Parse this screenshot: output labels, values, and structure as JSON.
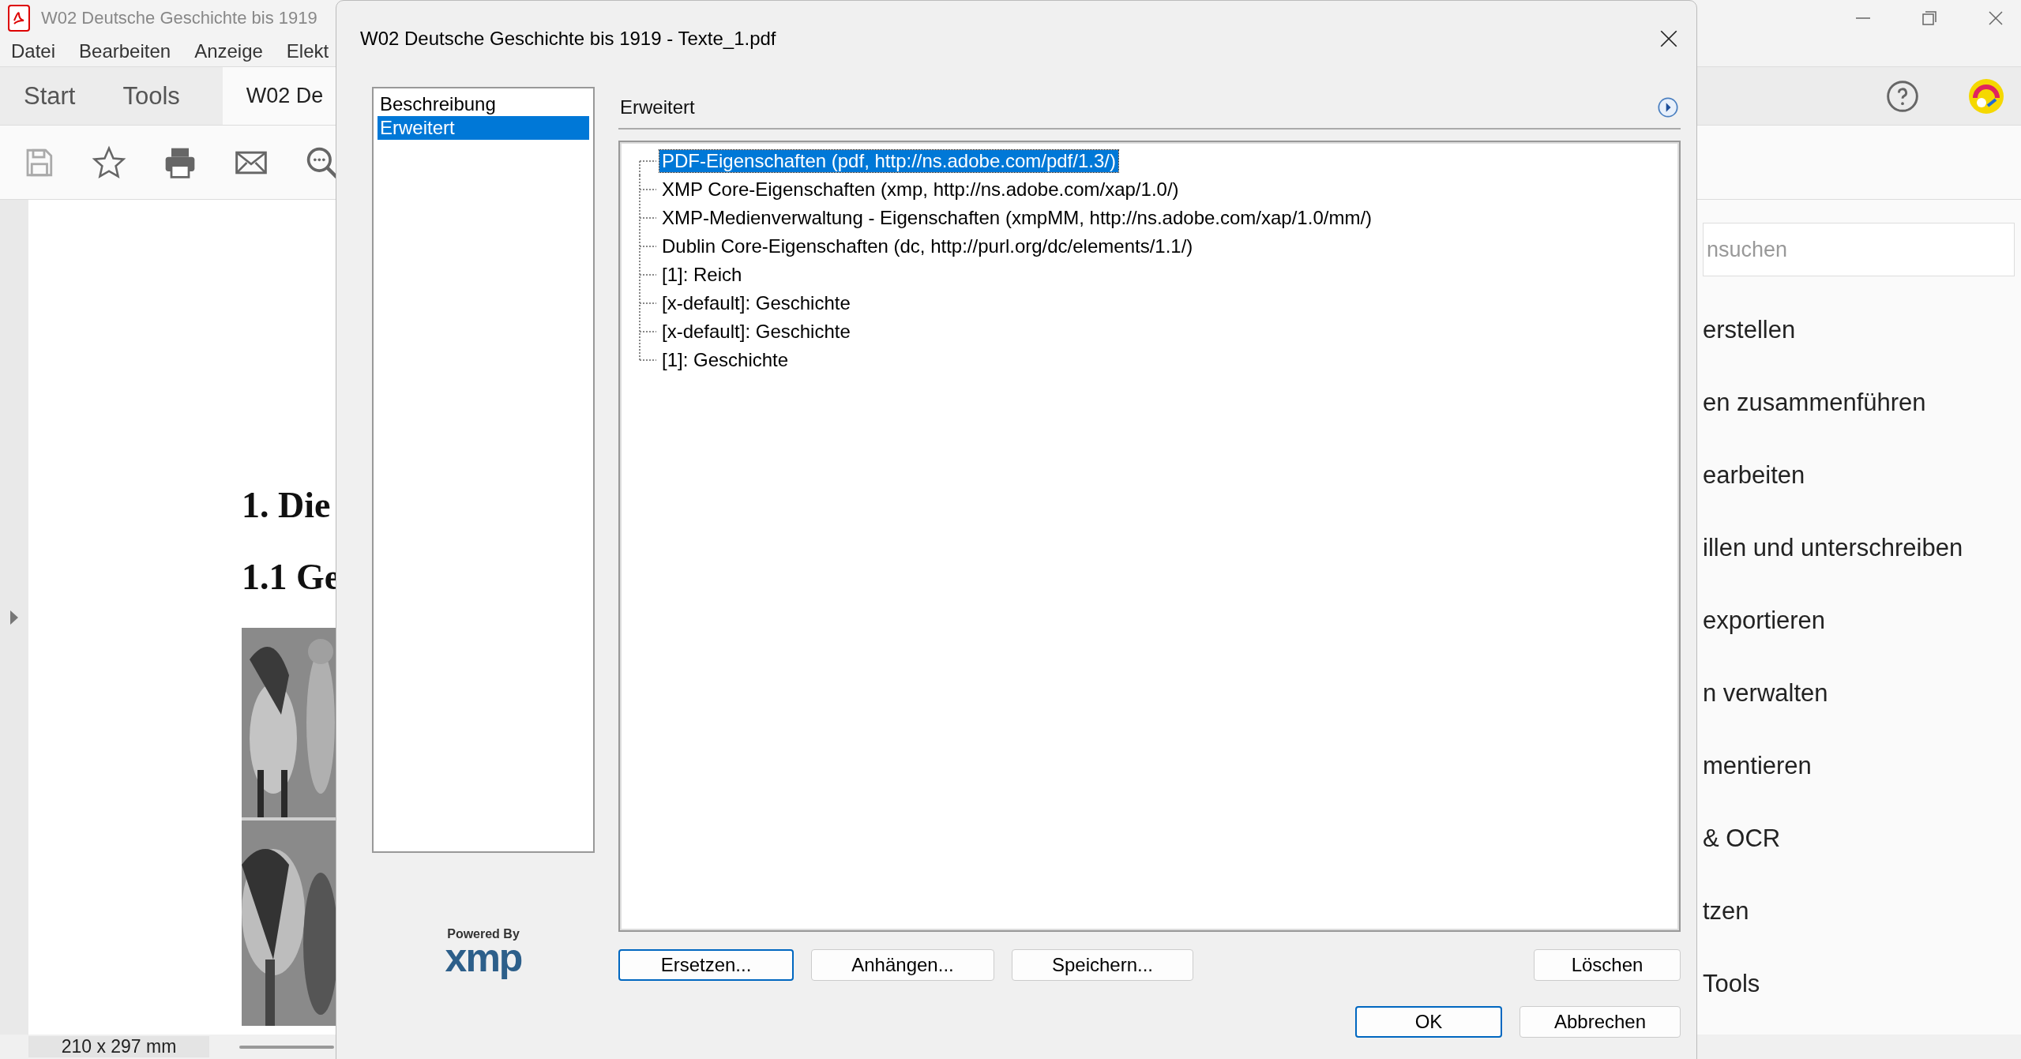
{
  "app": {
    "title": "W02 Deutsche Geschichte bis 1919",
    "menu": [
      "Datei",
      "Bearbeiten",
      "Anzeige",
      "Elekt"
    ],
    "tabs": [
      {
        "label": "Start",
        "selected": false
      },
      {
        "label": "Tools",
        "selected": false
      },
      {
        "label": "W02 De",
        "selected": true
      }
    ],
    "document": {
      "headings": [
        "1. Die",
        "1.1 Ge"
      ],
      "image": {
        "kind": "picture"
      }
    },
    "status_bar": {
      "page_size": "210 x 297 mm"
    }
  },
  "tools_panel": {
    "search": {
      "placeholder": "nsuchen"
    },
    "items": [
      "erstellen",
      "en zusammenführen",
      "earbeiten",
      "illen und unterschreiben",
      "exportieren",
      "n verwalten",
      "mentieren",
      "& OCR",
      "tzen",
      "Tools"
    ]
  },
  "dialog": {
    "title": "W02 Deutsche Geschichte bis 1919 - Texte_1.pdf",
    "categories": [
      {
        "label": "Beschreibung",
        "selected": false
      },
      {
        "label": "Erweitert",
        "selected": true
      }
    ],
    "section_title": "Erweitert",
    "tree": [
      {
        "label": "PDF-Eigenschaften (pdf, http://ns.adobe.com/pdf/1.3/)",
        "selected": true
      },
      {
        "label": "XMP Core-Eigenschaften (xmp, http://ns.adobe.com/xap/1.0/)",
        "selected": false
      },
      {
        "label": "XMP-Medienverwaltung - Eigenschaften (xmpMM, http://ns.adobe.com/xap/1.0/mm/)",
        "selected": false
      },
      {
        "label": "Dublin Core-Eigenschaften (dc, http://purl.org/dc/elements/1.1/)",
        "selected": false
      },
      {
        "label": "[1]: Reich",
        "selected": false
      },
      {
        "label": "[x-default]: Geschichte",
        "selected": false
      },
      {
        "label": "[x-default]: Geschichte",
        "selected": false
      },
      {
        "label": "[1]: Geschichte",
        "selected": false
      }
    ],
    "powered_by": "Powered By",
    "logo": "xmp",
    "buttons": [
      {
        "label": "Ersetzen...",
        "focused": true
      },
      {
        "label": "Anhängen...",
        "focused": false
      },
      {
        "label": "Speichern...",
        "focused": false
      }
    ],
    "delete_button": {
      "label": "Löschen",
      "focused": false
    },
    "footer_buttons": [
      {
        "label": "OK",
        "focused": true
      },
      {
        "label": "Abbrechen",
        "focused": false
      }
    ]
  }
}
